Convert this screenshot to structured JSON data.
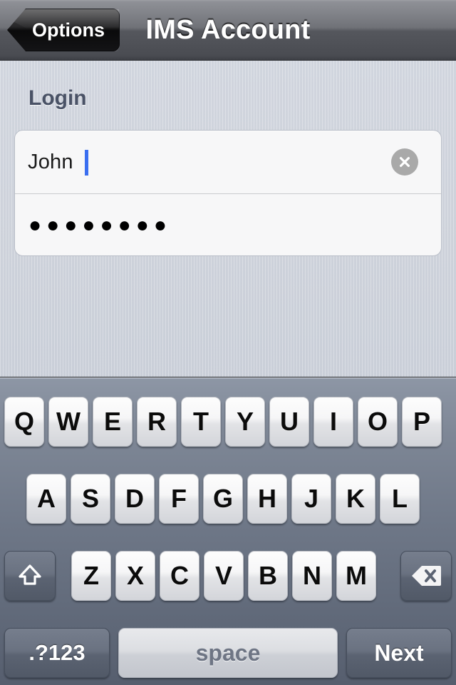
{
  "navbar": {
    "back_label": "Options",
    "title": "IMS Account"
  },
  "form": {
    "section_header": "Login",
    "username": {
      "value": "John",
      "clear_icon": "clear-circle-x-icon",
      "caret_visible": true
    },
    "password": {
      "masked_value": "●●●●●●●●",
      "character_count": 8
    }
  },
  "keyboard": {
    "row1": [
      "Q",
      "W",
      "E",
      "R",
      "T",
      "Y",
      "U",
      "I",
      "O",
      "P"
    ],
    "row2": [
      "A",
      "S",
      "D",
      "F",
      "G",
      "H",
      "J",
      "K",
      "L"
    ],
    "row3": [
      "Z",
      "X",
      "C",
      "V",
      "B",
      "N",
      "M"
    ],
    "shift_icon": "shift-arrow-up-icon",
    "backspace_icon": "backspace-delete-icon",
    "symbols_label": ".?123",
    "space_label": "space",
    "return_label": "Next"
  },
  "colors": {
    "caret": "#3a6ef0",
    "section_header": "#4a5266",
    "content_bg": "#d4d8e0",
    "navbar_dark": "#55575d",
    "clear_button": "#a9a9a9"
  }
}
